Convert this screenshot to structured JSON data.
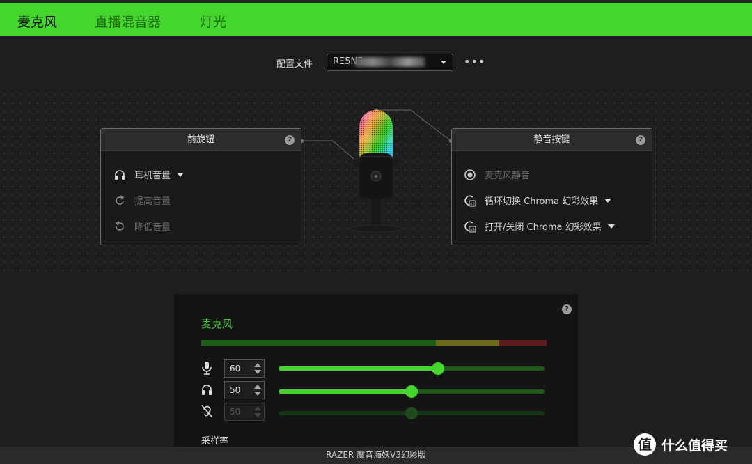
{
  "tabs": [
    {
      "label": "麦克风",
      "active": true
    },
    {
      "label": "直播混音器",
      "active": false
    },
    {
      "label": "灯光",
      "active": false
    }
  ],
  "profile": {
    "label": "配置文件",
    "value": "RΞ5NΞ",
    "more": "•••"
  },
  "front_knob": {
    "title": "前旋钮",
    "help": "?",
    "items": [
      {
        "label": "耳机音量",
        "icon": "headphones-icon",
        "enabled": true
      },
      {
        "label": "提高音量",
        "icon": "rotate-cw-icon",
        "enabled": false
      },
      {
        "label": "降低音量",
        "icon": "rotate-ccw-icon",
        "enabled": false
      }
    ]
  },
  "mute_button": {
    "title": "静音按键",
    "help": "?",
    "items": [
      {
        "label": "麦克风静音",
        "icon": "radio-icon",
        "enabled": false
      },
      {
        "label": "循环切换 Chroma 幻彩效果",
        "icon": "chroma-x2-icon",
        "enabled": true
      },
      {
        "label": "打开/关闭 Chroma 幻彩效果",
        "icon": "chroma-x3-icon",
        "enabled": true
      }
    ]
  },
  "mixer": {
    "title": "麦克风",
    "help": "?",
    "meter": {
      "green": 0.68,
      "yellow": 0.18,
      "red": 0.14
    },
    "rows": [
      {
        "icon": "microphone-icon",
        "value": "60",
        "level": 60,
        "enabled": true
      },
      {
        "icon": "headphones-icon",
        "value": "50",
        "level": 50,
        "enabled": true
      },
      {
        "icon": "ear-off-icon",
        "value": "50",
        "level": 50,
        "enabled": false
      }
    ],
    "sample_rate_label": "采样率"
  },
  "device_name": "RAZER 魔音海妖V3幻彩版",
  "watermark": {
    "logo": "值",
    "text": "什么值得买"
  },
  "colors": {
    "accent": "#44d62c",
    "bg": "#1e1e1e"
  }
}
